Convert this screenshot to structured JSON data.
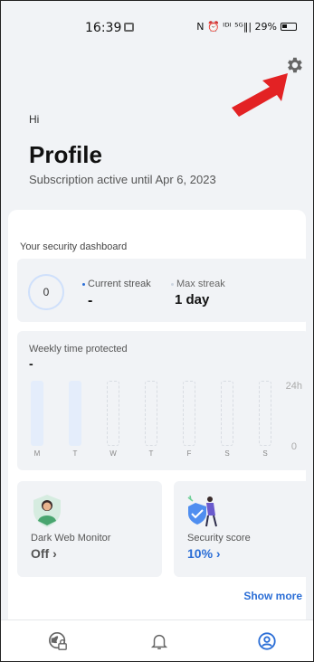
{
  "status_bar": {
    "time": "16:39",
    "right_text": "N ⏰ ᴵᴰᴵ ⁵ᴳ‖| 29%"
  },
  "header": {
    "greeting": "Hi",
    "title": "Profile",
    "subscription": "Subscription active until Apr 6, 2023"
  },
  "dashboard": {
    "heading": "Your security dashboard",
    "streak": {
      "ring_value": "0",
      "current_label": "Current streak",
      "current_value": "-",
      "max_label": "Max streak",
      "max_value": "1 day"
    },
    "weekly": {
      "label": "Weekly time protected",
      "value": "-",
      "axis_max": "24h",
      "axis_min": "0",
      "days": [
        {
          "label": "M",
          "active": true
        },
        {
          "label": "T",
          "active": true
        },
        {
          "label": "W",
          "active": false
        },
        {
          "label": "T",
          "active": false
        },
        {
          "label": "F",
          "active": false
        },
        {
          "label": "S",
          "active": false
        },
        {
          "label": "S",
          "active": false
        }
      ]
    },
    "dark_web": {
      "label": "Dark Web Monitor",
      "value": "Off ›"
    },
    "security_score": {
      "label": "Security score",
      "value": "10% ›"
    },
    "show_more": "Show more"
  },
  "colors": {
    "accent": "#2b6ed6",
    "arrow": "#e32224",
    "page_bg": "#f1f3f6",
    "card_bg": "#ffffff"
  },
  "nav": {
    "items": [
      {
        "icon": "globe-lock-icon"
      },
      {
        "icon": "bell-icon"
      },
      {
        "icon": "account-icon",
        "active": true
      }
    ]
  }
}
